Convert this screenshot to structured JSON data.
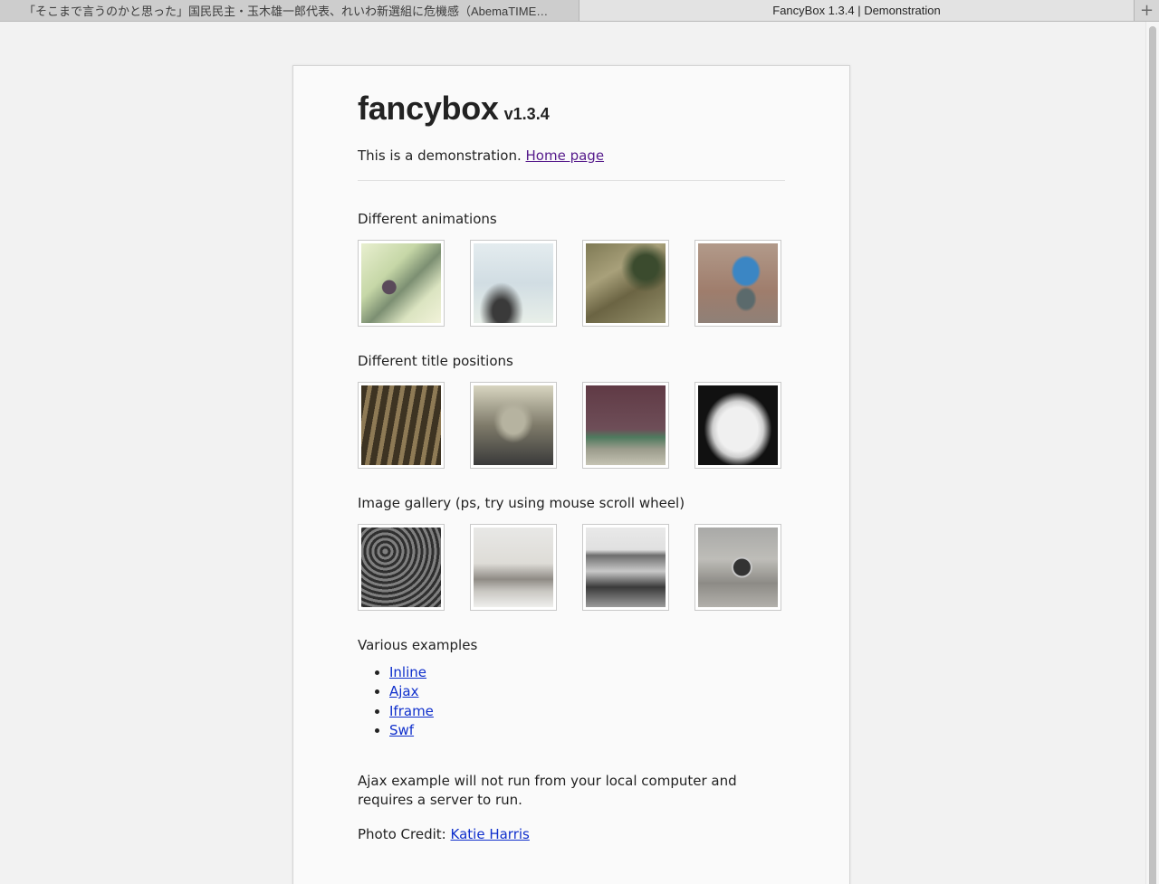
{
  "tabs": [
    {
      "label": "「そこまで言うのかと思った」国民民主・玉木雄一郎代表、れいわ新選組に危機感（AbemaTIMES） - Yahoo!ニ...",
      "active": false
    },
    {
      "label": "FancyBox 1.3.4 | Demonstration",
      "active": true
    }
  ],
  "new_tab_symbol": "+",
  "page": {
    "title": "fancybox",
    "version": "v1.3.4",
    "intro_text": "This is a demonstration.",
    "home_link": "Home page",
    "sections": {
      "animations": "Different animations",
      "title_positions": "Different title positions",
      "gallery": "Image gallery (ps, try using mouse scroll wheel)",
      "various": "Various examples"
    },
    "examples": [
      "Inline",
      "Ajax",
      "Iframe",
      "Swf"
    ],
    "note": "Ajax example will not run from your local computer and requires a server to run.",
    "credit_label": "Photo Credit:",
    "credit_link": "Katie Harris"
  },
  "colors": {
    "link": "#1a0dab",
    "visited_link": "#551a8b",
    "text": "#222222"
  }
}
